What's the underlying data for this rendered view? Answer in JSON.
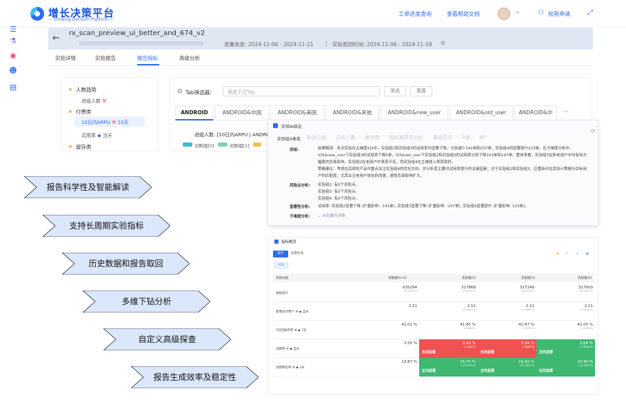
{
  "header": {
    "logo_title": "增长决策平台",
    "logo_subtitle": "— Growing Decision Platform —",
    "links": [
      "工单进度查询",
      "查看帮助文档"
    ],
    "apply_label": "权限申请"
  },
  "experiment": {
    "title": "rx_scan_preview_ui_better_and_674_v2",
    "flow_info": "流量信息: 2024-11-06 - 2024-11-21",
    "actual_time": "实际观测时间: 2024-11-06 - 2024-11-19"
  },
  "tabs": [
    "实验详情",
    "实验报告",
    "报告指标",
    "高级分析"
  ],
  "metrics": {
    "categories": [
      {
        "label": "人数趋势",
        "items": [
          {
            "label": "进组人数"
          }
        ]
      },
      {
        "label": "付费类",
        "items": [
          {
            "label": "10日内ARPU",
            "badge": "10天"
          },
          {
            "label": "试用率",
            "badge": "当天"
          }
        ]
      },
      {
        "label": "留存类",
        "items": []
      }
    ]
  },
  "filter": {
    "label": "Tab筛选器:",
    "placeholder": "筛选下方Tab",
    "btn_filter": "筛选",
    "btn_reset": "重置"
  },
  "country_tabs": [
    "ANDROID",
    "ANDROID&中国",
    "ANDROID&美国",
    "ANDROID&其他",
    "ANDROID&new_user",
    "ANDROID&old_user",
    "ANDROID&中",
    "···"
  ],
  "series_label": "进组人数: [10日内ARPU | ANDROID",
  "legend": [
    "对照组[0]",
    "对照组[1]"
  ],
  "ai": {
    "header": "实验AI结论",
    "ghost_headers": [
      "实验分组",
      "日均人数",
      "绝对值",
      "相对差异百分比",
      "置信区间",
      "P值",
      "BF"
    ],
    "section": "实验组4表现",
    "rows": [
      {
        "label": "总结:",
        "text": "结果解读：本次实验在主维度iOS中，实验组2和实验组3的试用率均显著下降，分别减少142单和237单，实验组4则显著提升123单。在子维度分析中，iOS&new_user下实验组3的试用率下降5单，iOS&old_user下实验组2和实验组3的试用率分别下降103单和147单。整体来看，实验组3在新老用户中均有较大幅度的负面影响，实验组2在老用户中表现不佳，而实验组4在主维度上表现良好。"
      },
      {
        "label": "",
        "text": "策略建议：考虑在后续的产品中重点关注实验组4的优化方向，并分析其主要对试用率提升的关键因素；对于实验组2和实验组3，应重新评估其设计策略与目标用户的匹配度，尤其关注老用户体验的改善，避免负面影响扩大。"
      },
      {
        "label": "风险点分析:",
        "text": "实验组2: 有0个风险点。"
      },
      {
        "label": "",
        "text": "实验组3: 有0个风险点。"
      },
      {
        "label": "",
        "text": "实验组4: 有0个风险点。"
      },
      {
        "label": "显著性分析:",
        "text": "试用率: 实验组2显著下降 (扩量影响: -142单), 实验组3显著下降 (扩量影响: -237单), 实验组4显著提升 (扩量影响: 123单)。"
      },
      {
        "label": "子维度分析:",
        "text": "点击展开详情"
      }
    ]
  },
  "features": [
    "报告科学性及智能解读",
    "支持长周期实验指标",
    "历史数据和报告取回",
    "多维下钻分析",
    "自定义高级探查",
    "报告生成效率及稳定性"
  ],
  "overview": {
    "title": "指标概览",
    "view_tabs": [
      "统计",
      "质量检测"
    ],
    "dim_tag": "iOS",
    "columns": [
      "实验分组",
      "对照组[0+1]",
      "实验组[2]",
      "实验组[3]",
      "实验组[4]"
    ],
    "rows": [
      {
        "name": "进组总计",
        "cells": [
          {
            "v": "635294",
            "s": "39.9978 %"
          },
          {
            "v": "317868",
            "s": "20.0122 %"
          },
          {
            "v": "317249",
            "s": "19.9733 %"
          },
          {
            "v": "317920",
            "s": "20.0161 %"
          }
        ]
      },
      {
        "name": "新增支付用户",
        "tag": "当天",
        "cells": [
          {
            "v": "2.11",
            "s": ""
          },
          {
            "v": "2.11",
            "s": "+0.0000 %"
          },
          {
            "v": "2.12",
            "s": "+0.0000 %"
          },
          {
            "v": "2.11",
            "s": "+0.0000 %"
          }
        ]
      },
      {
        "name": "7日内留存率",
        "tag": "7天",
        "cells": [
          {
            "v": "42.01 %",
            "s": ""
          },
          {
            "v": "41.85 %",
            "s": "-0.3865 %"
          },
          {
            "v": "41.87 %",
            "s": "-0.3378 %"
          },
          {
            "v": "42.00 %",
            "s": "-0.0238 %"
          }
        ]
      },
      {
        "name": "试用率",
        "tag": "当天",
        "cells": [
          {
            "v": "3.55 %",
            "s": ""
          },
          {
            "v": "3.43 %",
            "s": "-3.2263 %",
            "tag": "负向显著",
            "kind": "red"
          },
          {
            "v": "3.34 %",
            "s": "-5.8880 %",
            "tag": "负向显著",
            "kind": "red"
          },
          {
            "v": "3.68 %",
            "s": "+3.6048 %",
            "tag": "正向显著",
            "kind": "grn"
          }
        ]
      },
      {
        "name": "试用转化率",
        "tag": "3天",
        "cells": [
          {
            "v": "13.87 %",
            "s": ""
          },
          {
            "v": "15.75 %",
            "s": "+13.5733 %",
            "tag": "正向显著",
            "kind": "grn"
          },
          {
            "v": "15.42 %",
            "s": "+11.1827 %",
            "tag": "正向显著",
            "kind": "grn"
          },
          {
            "v": "15.95 %",
            "s": "+15.0043 %",
            "tag": "正向显著",
            "kind": "grn"
          }
        ]
      }
    ]
  }
}
